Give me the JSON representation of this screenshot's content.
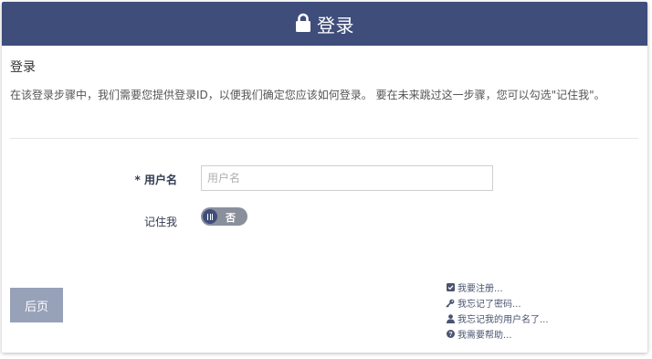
{
  "header": {
    "title": "登录",
    "icon": "lock-icon",
    "background": "#3f4d7b"
  },
  "section": {
    "title": "登录",
    "description": "在该登录步骤中，我们需要您提供登录ID，以便我们确定您应该如何登录。 要在未来跳过这一步骤，您可以勾选\"记住我\"。"
  },
  "form": {
    "username_label": "用户名",
    "required_mark": "*",
    "username_value": "",
    "username_placeholder": "用户名",
    "remember_label": "记住我",
    "remember_state": "否"
  },
  "footer": {
    "back_label": "后页",
    "back_color": "#97a1b8",
    "links": [
      {
        "icon": "check-square-icon",
        "label": "我要注册..."
      },
      {
        "icon": "key-icon",
        "label": "我忘记了密码..."
      },
      {
        "icon": "user-icon",
        "label": "我忘记我的用户名了..."
      },
      {
        "icon": "question-circle-icon",
        "label": "我需要帮助..."
      }
    ]
  }
}
